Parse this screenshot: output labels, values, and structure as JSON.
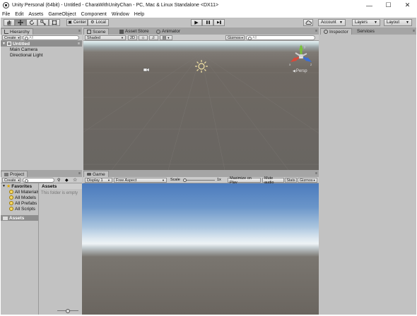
{
  "window": {
    "title": "Unity Personal (64bit) - Untitled - CharaWithUnityChan - PC, Mac & Linux Standalone <DX11>",
    "minimize": "—",
    "maximize": "☐",
    "close": "✕"
  },
  "menu": [
    "File",
    "Edit",
    "Assets",
    "GameObject",
    "Component",
    "Window",
    "Help"
  ],
  "toolbar": {
    "tools": [
      "hand-icon",
      "move-icon",
      "rotate-icon",
      "scale-icon",
      "rect-icon"
    ],
    "active_tool": "move-icon",
    "pivot_label": "Center",
    "space_label": "Local",
    "play": "▶",
    "pause": "❚❚",
    "step": "▶❚",
    "account_label": "Account",
    "layers_label": "Layers",
    "layout_label": "Layout"
  },
  "hierarchy": {
    "tab": "Hierarchy",
    "create_label": "Create",
    "search_placeholder": "All",
    "scene_name": "Untitled",
    "items": [
      "Main Camera",
      "Directional Light"
    ]
  },
  "scene": {
    "tabs": [
      "Scene",
      "Asset Store",
      "Animator"
    ],
    "shading": "Shaded",
    "mode_2d": "2D",
    "gizmos_label": "Gizmos",
    "search_placeholder": "All",
    "persp_label": "Persp",
    "gizmo_axes": {
      "y": "y",
      "x": "x",
      "z": "z"
    }
  },
  "inspector": {
    "tabs": [
      "Inspector",
      "Services"
    ]
  },
  "project": {
    "tab": "Project",
    "create_label": "Create",
    "favorites_label": "Favorites",
    "favorites": [
      "All Materials",
      "All Models",
      "All Prefabs",
      "All Scripts"
    ],
    "assets_label": "Assets",
    "path_label": "Assets",
    "empty_text": "This folder is empty"
  },
  "game": {
    "tab": "Game",
    "display": "Display 1",
    "aspect": "Free Aspect",
    "scale_label": "Scale",
    "scale_value": "1x",
    "maximize_label": "Maximize on Play",
    "mute_label": "Mute audio",
    "stats_label": "Stats",
    "gizmos_label": "Gizmos"
  },
  "colors": {
    "editor_bg": "#c2c2c2",
    "tab_strip": "#a5a5a5",
    "selection": "#8e8e8e",
    "scene_ground": "#686561",
    "sky_top": "#4b7bbd"
  }
}
